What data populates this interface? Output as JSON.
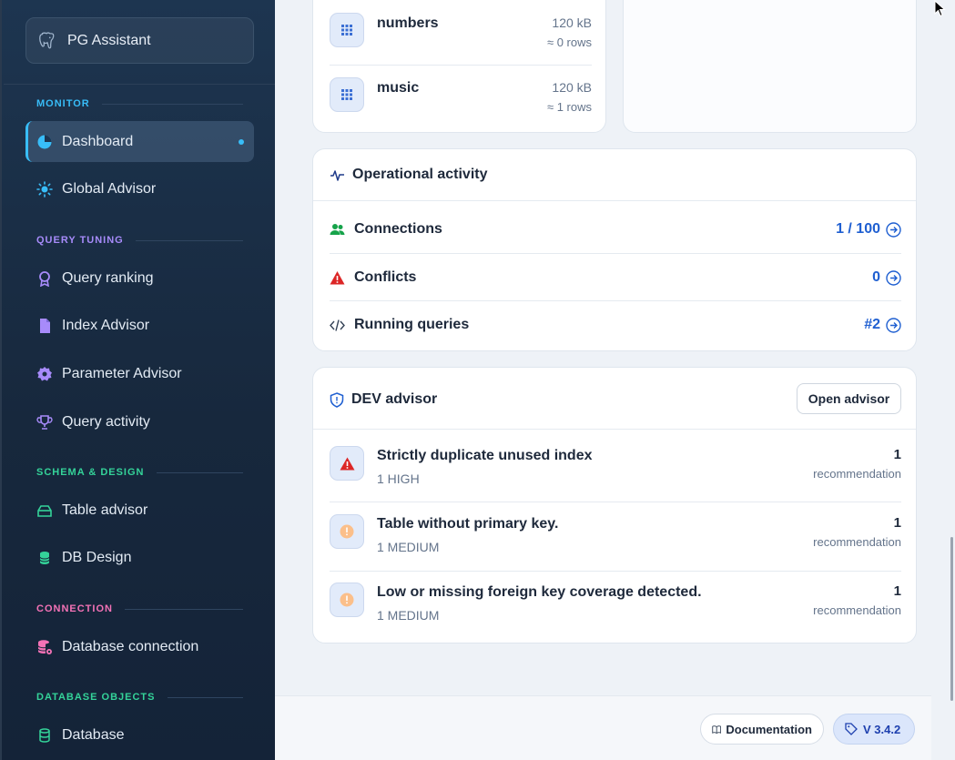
{
  "app": {
    "title": "PG Assistant"
  },
  "sidebar": {
    "sections": [
      {
        "label": "MONITOR",
        "color": "#38bdf8"
      },
      {
        "label": "QUERY TUNING",
        "color": "#a78bfa"
      },
      {
        "label": "SCHEMA & DESIGN",
        "color": "#34d399"
      },
      {
        "label": "CONNECTION",
        "color": "#f472b6"
      },
      {
        "label": "DATABASE OBJECTS",
        "color": "#34d399"
      }
    ],
    "items": [
      {
        "label": "Dashboard",
        "icon": "pie-chart-icon",
        "active": true
      },
      {
        "label": "Global Advisor",
        "icon": "sun-icon"
      },
      {
        "label": "Query ranking",
        "icon": "award-icon"
      },
      {
        "label": "Index Advisor",
        "icon": "file-icon"
      },
      {
        "label": "Parameter Advisor",
        "icon": "gear-icon"
      },
      {
        "label": "Query activity",
        "icon": "trophy-icon"
      },
      {
        "label": "Table advisor",
        "icon": "layers-icon"
      },
      {
        "label": "DB Design",
        "icon": "database-icon"
      },
      {
        "label": "Database connection",
        "icon": "database-gear-icon"
      },
      {
        "label": "Database",
        "icon": "database-icon"
      }
    ]
  },
  "tables": [
    {
      "name": "numbers",
      "size": "120 kB",
      "rows": "≈ 0 rows"
    },
    {
      "name": "music",
      "size": "120 kB",
      "rows": "≈ 1 rows"
    }
  ],
  "operational": {
    "title": "Operational activity",
    "rows": [
      {
        "label": "Connections",
        "value": "1 / 100",
        "icon": "users-icon"
      },
      {
        "label": "Conflicts",
        "value": "0",
        "icon": "warning-icon"
      },
      {
        "label": "Running queries",
        "value": "#2",
        "icon": "code-icon"
      }
    ]
  },
  "dev_advisor": {
    "title": "DEV advisor",
    "open_button": "Open advisor",
    "items": [
      {
        "title": "Strictly duplicate unused index",
        "severity": "1 HIGH",
        "count": "1",
        "unit": "recommendation"
      },
      {
        "title": "Table without primary key.",
        "severity": "1 MEDIUM",
        "count": "1",
        "unit": "recommendation"
      },
      {
        "title": "Low or missing foreign key coverage detected.",
        "severity": "1 MEDIUM",
        "count": "1",
        "unit": "recommendation"
      }
    ]
  },
  "footer": {
    "documentation": "Documentation",
    "version": "V 3.4.2"
  }
}
